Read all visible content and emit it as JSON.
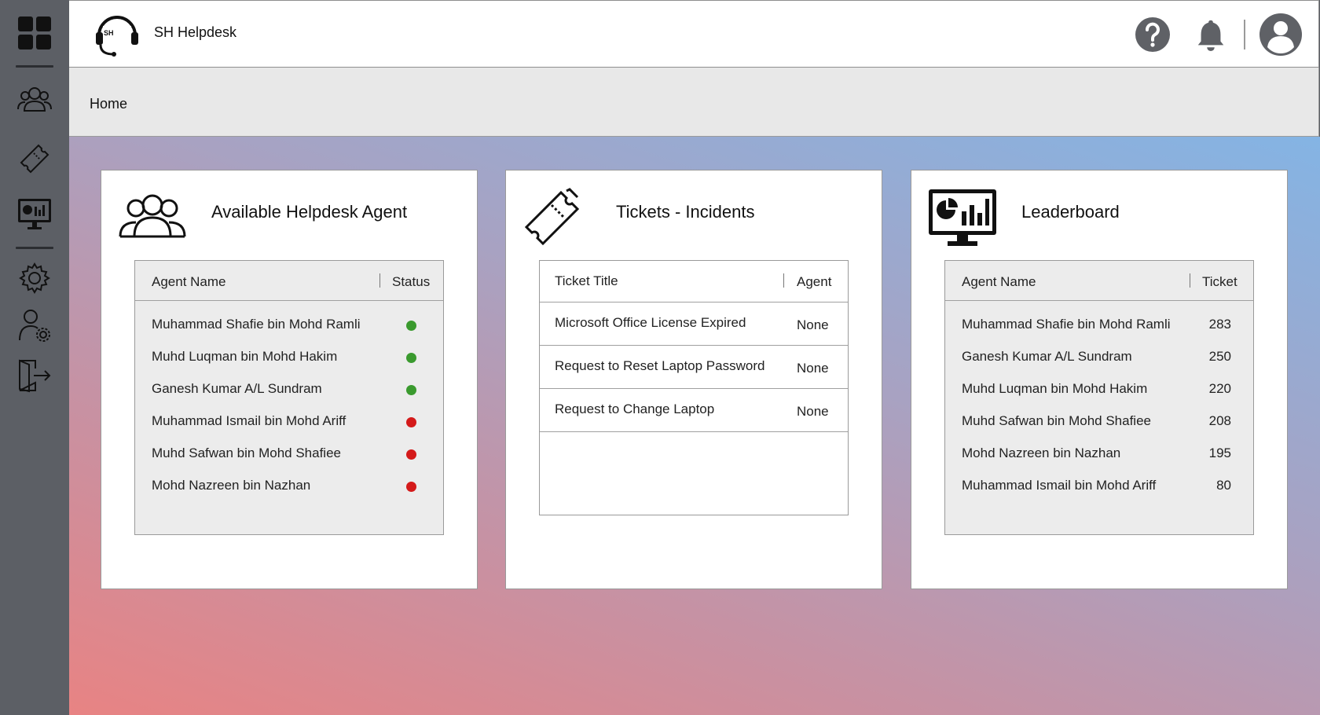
{
  "app": {
    "title": "SH Helpdesk",
    "logo_text": "SH"
  },
  "breadcrumb": {
    "home": "Home"
  },
  "sidebar": {
    "items": [
      {
        "name": "dashboard",
        "icon": "dashboard-grid-icon"
      },
      {
        "name": "agents",
        "icon": "users-icon"
      },
      {
        "name": "tickets",
        "icon": "ticket-icon"
      },
      {
        "name": "leaderboard",
        "icon": "monitor-chart-icon"
      },
      {
        "name": "settings",
        "icon": "gear-icon"
      },
      {
        "name": "user-settings",
        "icon": "user-gear-icon"
      },
      {
        "name": "logout",
        "icon": "logout-icon"
      }
    ]
  },
  "topbar": {
    "icons": [
      "help-icon",
      "bell-icon",
      "user-avatar-icon"
    ]
  },
  "agents_card": {
    "title": "Available Helpdesk Agent",
    "col_name": "Agent Name",
    "col_status": "Status",
    "rows": [
      {
        "name": "Muhammad Shafie bin Mohd Ramli",
        "status": "available"
      },
      {
        "name": "Muhd Luqman bin Mohd Hakim",
        "status": "available"
      },
      {
        "name": "Ganesh Kumar A/L Sundram",
        "status": "available"
      },
      {
        "name": "Muhammad Ismail bin Mohd Ariff",
        "status": "unavailable"
      },
      {
        "name": "Muhd Safwan bin Mohd Shafiee",
        "status": "unavailable"
      },
      {
        "name": "Mohd Nazreen bin Nazhan",
        "status": "unavailable"
      }
    ]
  },
  "tickets_card": {
    "title": "Tickets - Incidents",
    "col_title": "Ticket Title",
    "col_agent": "Agent",
    "rows": [
      {
        "title": "Microsoft Office License Expired",
        "agent": "None"
      },
      {
        "title": "Request to Reset Laptop Password",
        "agent": "None"
      },
      {
        "title": "Request to Change Laptop",
        "agent": "None"
      }
    ]
  },
  "leaderboard_card": {
    "title": "Leaderboard",
    "col_name": "Agent Name",
    "col_ticket": "Ticket",
    "rows": [
      {
        "name": "Muhammad Shafie bin Mohd Ramli",
        "tickets": "283"
      },
      {
        "name": "Ganesh Kumar A/L Sundram",
        "tickets": "250"
      },
      {
        "name": "Muhd Luqman bin Mohd Hakim",
        "tickets": "220"
      },
      {
        "name": "Muhd Safwan bin Mohd Shafiee",
        "tickets": "208"
      },
      {
        "name": "Mohd Nazreen bin Nazhan",
        "tickets": "195"
      },
      {
        "name": "Muhammad Ismail bin Mohd Ariff",
        "tickets": "80"
      }
    ]
  },
  "colors": {
    "available": "#3a9a2e",
    "unavailable": "#d41a1a",
    "sidebar": "#5c5f65"
  }
}
